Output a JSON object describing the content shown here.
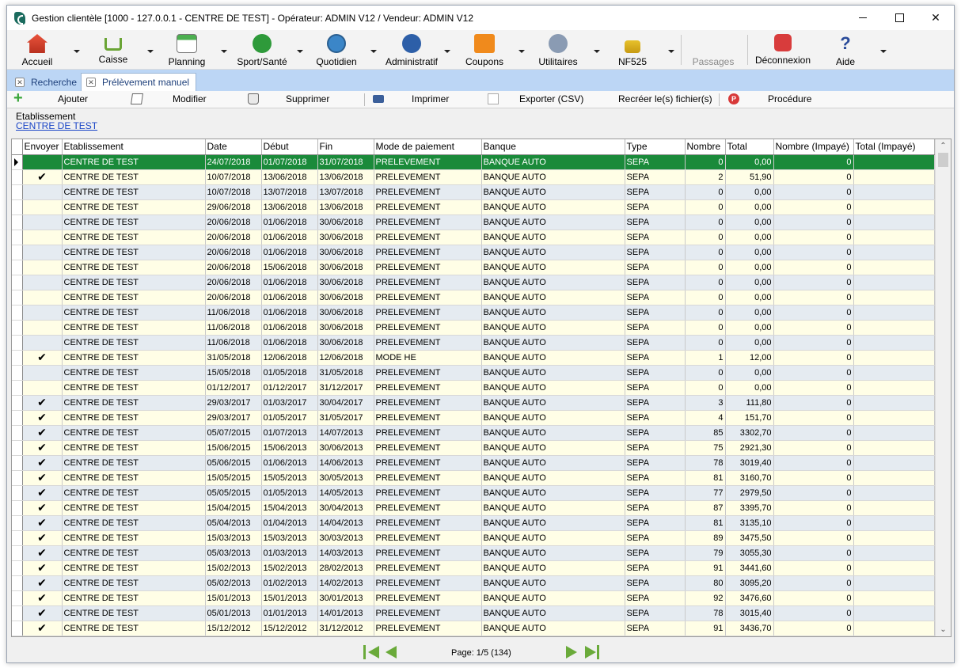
{
  "window": {
    "title": "Gestion clientèle [1000 - 127.0.0.1 - CENTRE DE TEST] - Opérateur: ADMIN V12 / Vendeur: ADMIN V12",
    "close_glyph": "✕"
  },
  "toolbar": {
    "accueil": "Accueil",
    "caisse": "Caisse",
    "planning": "Planning",
    "sport": "Sport/Santé",
    "quotidien": "Quotidien",
    "administratif": "Administratif",
    "coupons": "Coupons",
    "utilitaires": "Utilitaires",
    "nf525": "NF525",
    "passages": "Passages",
    "deconnexion": "Déconnexion",
    "aide": "Aide",
    "help_glyph": "?"
  },
  "tabs": {
    "recherche": "Recherche",
    "prelevement": "Prélèvement manuel",
    "close_glyph": "✕"
  },
  "actions": {
    "ajouter": "Ajouter",
    "modifier": "Modifier",
    "supprimer": "Supprimer",
    "imprimer": "Imprimer",
    "exporter": "Exporter (CSV)",
    "recreer": "Recréer le(s) fichier(s)",
    "procedure": "Procédure",
    "proc_glyph": "P",
    "plus_glyph": "+"
  },
  "filter": {
    "label": "Etablissement",
    "value": "CENTRE DE TEST"
  },
  "grid": {
    "columns": {
      "envoyer": "Envoyer",
      "etablissement": "Etablissement",
      "date": "Date",
      "debut": "Début",
      "fin": "Fin",
      "mode": "Mode de paiement",
      "banque": "Banque",
      "type": "Type",
      "nombre": "Nombre",
      "total": "Total",
      "nombre_impaye": "Nombre (Impayé)",
      "total_impaye": "Total (Impayé)"
    },
    "check_glyph": "✔",
    "selected_row": 0,
    "rows": [
      {
        "envoyer": false,
        "etablissement": "CENTRE DE TEST",
        "date": "24/07/2018",
        "debut": "01/07/2018",
        "fin": "31/07/2018",
        "mode": "PRELEVEMENT",
        "banque": "BANQUE AUTO",
        "type": "SEPA",
        "nombre": "0",
        "total": "0,00",
        "nombre_impaye": "0",
        "total_impaye": ""
      },
      {
        "envoyer": true,
        "etablissement": "CENTRE DE TEST",
        "date": "10/07/2018",
        "debut": "13/06/2018",
        "fin": "13/06/2018",
        "mode": "PRELEVEMENT",
        "banque": "BANQUE AUTO",
        "type": "SEPA",
        "nombre": "2",
        "total": "51,90",
        "nombre_impaye": "0",
        "total_impaye": ""
      },
      {
        "envoyer": false,
        "etablissement": "CENTRE DE TEST",
        "date": "10/07/2018",
        "debut": "13/07/2018",
        "fin": "13/07/2018",
        "mode": "PRELEVEMENT",
        "banque": "BANQUE AUTO",
        "type": "SEPA",
        "nombre": "0",
        "total": "0,00",
        "nombre_impaye": "0",
        "total_impaye": ""
      },
      {
        "envoyer": false,
        "etablissement": "CENTRE DE TEST",
        "date": "29/06/2018",
        "debut": "13/06/2018",
        "fin": "13/06/2018",
        "mode": "PRELEVEMENT",
        "banque": "BANQUE AUTO",
        "type": "SEPA",
        "nombre": "0",
        "total": "0,00",
        "nombre_impaye": "0",
        "total_impaye": ""
      },
      {
        "envoyer": false,
        "etablissement": "CENTRE DE TEST",
        "date": "20/06/2018",
        "debut": "01/06/2018",
        "fin": "30/06/2018",
        "mode": "PRELEVEMENT",
        "banque": "BANQUE AUTO",
        "type": "SEPA",
        "nombre": "0",
        "total": "0,00",
        "nombre_impaye": "0",
        "total_impaye": ""
      },
      {
        "envoyer": false,
        "etablissement": "CENTRE DE TEST",
        "date": "20/06/2018",
        "debut": "01/06/2018",
        "fin": "30/06/2018",
        "mode": "PRELEVEMENT",
        "banque": "BANQUE AUTO",
        "type": "SEPA",
        "nombre": "0",
        "total": "0,00",
        "nombre_impaye": "0",
        "total_impaye": ""
      },
      {
        "envoyer": false,
        "etablissement": "CENTRE DE TEST",
        "date": "20/06/2018",
        "debut": "01/06/2018",
        "fin": "30/06/2018",
        "mode": "PRELEVEMENT",
        "banque": "BANQUE AUTO",
        "type": "SEPA",
        "nombre": "0",
        "total": "0,00",
        "nombre_impaye": "0",
        "total_impaye": ""
      },
      {
        "envoyer": false,
        "etablissement": "CENTRE DE TEST",
        "date": "20/06/2018",
        "debut": "15/06/2018",
        "fin": "30/06/2018",
        "mode": "PRELEVEMENT",
        "banque": "BANQUE AUTO",
        "type": "SEPA",
        "nombre": "0",
        "total": "0,00",
        "nombre_impaye": "0",
        "total_impaye": ""
      },
      {
        "envoyer": false,
        "etablissement": "CENTRE DE TEST",
        "date": "20/06/2018",
        "debut": "01/06/2018",
        "fin": "30/06/2018",
        "mode": "PRELEVEMENT",
        "banque": "BANQUE AUTO",
        "type": "SEPA",
        "nombre": "0",
        "total": "0,00",
        "nombre_impaye": "0",
        "total_impaye": ""
      },
      {
        "envoyer": false,
        "etablissement": "CENTRE DE TEST",
        "date": "20/06/2018",
        "debut": "01/06/2018",
        "fin": "30/06/2018",
        "mode": "PRELEVEMENT",
        "banque": "BANQUE AUTO",
        "type": "SEPA",
        "nombre": "0",
        "total": "0,00",
        "nombre_impaye": "0",
        "total_impaye": ""
      },
      {
        "envoyer": false,
        "etablissement": "CENTRE DE TEST",
        "date": "11/06/2018",
        "debut": "01/06/2018",
        "fin": "30/06/2018",
        "mode": "PRELEVEMENT",
        "banque": "BANQUE AUTO",
        "type": "SEPA",
        "nombre": "0",
        "total": "0,00",
        "nombre_impaye": "0",
        "total_impaye": ""
      },
      {
        "envoyer": false,
        "etablissement": "CENTRE DE TEST",
        "date": "11/06/2018",
        "debut": "01/06/2018",
        "fin": "30/06/2018",
        "mode": "PRELEVEMENT",
        "banque": "BANQUE AUTO",
        "type": "SEPA",
        "nombre": "0",
        "total": "0,00",
        "nombre_impaye": "0",
        "total_impaye": ""
      },
      {
        "envoyer": false,
        "etablissement": "CENTRE DE TEST",
        "date": "11/06/2018",
        "debut": "01/06/2018",
        "fin": "30/06/2018",
        "mode": "PRELEVEMENT",
        "banque": "BANQUE AUTO",
        "type": "SEPA",
        "nombre": "0",
        "total": "0,00",
        "nombre_impaye": "0",
        "total_impaye": ""
      },
      {
        "envoyer": true,
        "etablissement": "CENTRE DE TEST",
        "date": "31/05/2018",
        "debut": "12/06/2018",
        "fin": "12/06/2018",
        "mode": "MODE HE",
        "banque": "BANQUE AUTO",
        "type": "SEPA",
        "nombre": "1",
        "total": "12,00",
        "nombre_impaye": "0",
        "total_impaye": ""
      },
      {
        "envoyer": false,
        "etablissement": "CENTRE DE TEST",
        "date": "15/05/2018",
        "debut": "01/05/2018",
        "fin": "31/05/2018",
        "mode": "PRELEVEMENT",
        "banque": "BANQUE AUTO",
        "type": "SEPA",
        "nombre": "0",
        "total": "0,00",
        "nombre_impaye": "0",
        "total_impaye": ""
      },
      {
        "envoyer": false,
        "etablissement": "CENTRE DE TEST",
        "date": "01/12/2017",
        "debut": "01/12/2017",
        "fin": "31/12/2017",
        "mode": "PRELEVEMENT",
        "banque": "BANQUE AUTO",
        "type": "SEPA",
        "nombre": "0",
        "total": "0,00",
        "nombre_impaye": "0",
        "total_impaye": ""
      },
      {
        "envoyer": true,
        "etablissement": "CENTRE DE TEST",
        "date": "29/03/2017",
        "debut": "01/03/2017",
        "fin": "30/04/2017",
        "mode": "PRELEVEMENT",
        "banque": "BANQUE AUTO",
        "type": "SEPA",
        "nombre": "3",
        "total": "111,80",
        "nombre_impaye": "0",
        "total_impaye": ""
      },
      {
        "envoyer": true,
        "etablissement": "CENTRE DE TEST",
        "date": "29/03/2017",
        "debut": "01/05/2017",
        "fin": "31/05/2017",
        "mode": "PRELEVEMENT",
        "banque": "BANQUE AUTO",
        "type": "SEPA",
        "nombre": "4",
        "total": "151,70",
        "nombre_impaye": "0",
        "total_impaye": ""
      },
      {
        "envoyer": true,
        "etablissement": "CENTRE DE TEST",
        "date": "05/07/2015",
        "debut": "01/07/2013",
        "fin": "14/07/2013",
        "mode": "PRELEVEMENT",
        "banque": "BANQUE AUTO",
        "type": "SEPA",
        "nombre": "85",
        "total": "3302,70",
        "nombre_impaye": "0",
        "total_impaye": ""
      },
      {
        "envoyer": true,
        "etablissement": "CENTRE DE TEST",
        "date": "15/06/2015",
        "debut": "15/06/2013",
        "fin": "30/06/2013",
        "mode": "PRELEVEMENT",
        "banque": "BANQUE AUTO",
        "type": "SEPA",
        "nombre": "75",
        "total": "2921,30",
        "nombre_impaye": "0",
        "total_impaye": ""
      },
      {
        "envoyer": true,
        "etablissement": "CENTRE DE TEST",
        "date": "05/06/2015",
        "debut": "01/06/2013",
        "fin": "14/06/2013",
        "mode": "PRELEVEMENT",
        "banque": "BANQUE AUTO",
        "type": "SEPA",
        "nombre": "78",
        "total": "3019,40",
        "nombre_impaye": "0",
        "total_impaye": ""
      },
      {
        "envoyer": true,
        "etablissement": "CENTRE DE TEST",
        "date": "15/05/2015",
        "debut": "15/05/2013",
        "fin": "30/05/2013",
        "mode": "PRELEVEMENT",
        "banque": "BANQUE AUTO",
        "type": "SEPA",
        "nombre": "81",
        "total": "3160,70",
        "nombre_impaye": "0",
        "total_impaye": ""
      },
      {
        "envoyer": true,
        "etablissement": "CENTRE DE TEST",
        "date": "05/05/2015",
        "debut": "01/05/2013",
        "fin": "14/05/2013",
        "mode": "PRELEVEMENT",
        "banque": "BANQUE AUTO",
        "type": "SEPA",
        "nombre": "77",
        "total": "2979,50",
        "nombre_impaye": "0",
        "total_impaye": ""
      },
      {
        "envoyer": true,
        "etablissement": "CENTRE DE TEST",
        "date": "15/04/2015",
        "debut": "15/04/2013",
        "fin": "30/04/2013",
        "mode": "PRELEVEMENT",
        "banque": "BANQUE AUTO",
        "type": "SEPA",
        "nombre": "87",
        "total": "3395,70",
        "nombre_impaye": "0",
        "total_impaye": ""
      },
      {
        "envoyer": true,
        "etablissement": "CENTRE DE TEST",
        "date": "05/04/2013",
        "debut": "01/04/2013",
        "fin": "14/04/2013",
        "mode": "PRELEVEMENT",
        "banque": "BANQUE AUTO",
        "type": "SEPA",
        "nombre": "81",
        "total": "3135,10",
        "nombre_impaye": "0",
        "total_impaye": ""
      },
      {
        "envoyer": true,
        "etablissement": "CENTRE DE TEST",
        "date": "15/03/2013",
        "debut": "15/03/2013",
        "fin": "30/03/2013",
        "mode": "PRELEVEMENT",
        "banque": "BANQUE AUTO",
        "type": "SEPA",
        "nombre": "89",
        "total": "3475,50",
        "nombre_impaye": "0",
        "total_impaye": ""
      },
      {
        "envoyer": true,
        "etablissement": "CENTRE DE TEST",
        "date": "05/03/2013",
        "debut": "01/03/2013",
        "fin": "14/03/2013",
        "mode": "PRELEVEMENT",
        "banque": "BANQUE AUTO",
        "type": "SEPA",
        "nombre": "79",
        "total": "3055,30",
        "nombre_impaye": "0",
        "total_impaye": ""
      },
      {
        "envoyer": true,
        "etablissement": "CENTRE DE TEST",
        "date": "15/02/2013",
        "debut": "15/02/2013",
        "fin": "28/02/2013",
        "mode": "PRELEVEMENT",
        "banque": "BANQUE AUTO",
        "type": "SEPA",
        "nombre": "91",
        "total": "3441,60",
        "nombre_impaye": "0",
        "total_impaye": ""
      },
      {
        "envoyer": true,
        "etablissement": "CENTRE DE TEST",
        "date": "05/02/2013",
        "debut": "01/02/2013",
        "fin": "14/02/2013",
        "mode": "PRELEVEMENT",
        "banque": "BANQUE AUTO",
        "type": "SEPA",
        "nombre": "80",
        "total": "3095,20",
        "nombre_impaye": "0",
        "total_impaye": ""
      },
      {
        "envoyer": true,
        "etablissement": "CENTRE DE TEST",
        "date": "15/01/2013",
        "debut": "15/01/2013",
        "fin": "30/01/2013",
        "mode": "PRELEVEMENT",
        "banque": "BANQUE AUTO",
        "type": "SEPA",
        "nombre": "92",
        "total": "3476,60",
        "nombre_impaye": "0",
        "total_impaye": ""
      },
      {
        "envoyer": true,
        "etablissement": "CENTRE DE TEST",
        "date": "05/01/2013",
        "debut": "01/01/2013",
        "fin": "14/01/2013",
        "mode": "PRELEVEMENT",
        "banque": "BANQUE AUTO",
        "type": "SEPA",
        "nombre": "78",
        "total": "3015,40",
        "nombre_impaye": "0",
        "total_impaye": ""
      },
      {
        "envoyer": true,
        "etablissement": "CENTRE DE TEST",
        "date": "15/12/2012",
        "debut": "15/12/2012",
        "fin": "31/12/2012",
        "mode": "PRELEVEMENT",
        "banque": "BANQUE AUTO",
        "type": "SEPA",
        "nombre": "91",
        "total": "3436,70",
        "nombre_impaye": "0",
        "total_impaye": ""
      }
    ]
  },
  "pager": {
    "text": "Page: 1/5 (134)"
  },
  "colors": {
    "selected_row": "#1a8a3a",
    "odd_row": "#fffee6",
    "even_row": "#e5ebf1",
    "tab_bar": "#bcd6f5",
    "pager_arrow": "#6aaa3a",
    "link": "#1b46c7"
  }
}
